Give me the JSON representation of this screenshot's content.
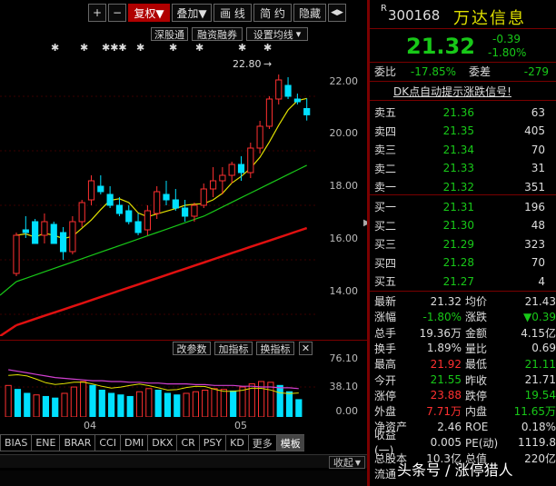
{
  "toolbar": {
    "plus": "+",
    "minus": "−",
    "fuquan": "复权▼",
    "diejia": "叠加▼",
    "huaxian": "画 线",
    "jianyue": "简 约",
    "yincang": "隐藏",
    "nav": "◀▶"
  },
  "sub_toolbar": {
    "shengutong": "深股通",
    "rongzi": "融资融券",
    "shezhi": "设置均线",
    "shezhi_arrow": "▾"
  },
  "main_chart": {
    "y_ticks": [
      "22.00",
      "20.00",
      "18.00",
      "16.00",
      "14.00"
    ],
    "high_label": "22.80",
    "ylim": [
      13.2,
      23.6
    ]
  },
  "sub_chart": {
    "buttons": [
      "改参数",
      "加指标",
      "换指标"
    ],
    "close": "✕",
    "y_ticks": [
      "76.10",
      "38.10",
      "0.00"
    ],
    "x_ticks": [
      "04",
      "05"
    ]
  },
  "indicator_tabs": [
    "BIAS",
    "ENE",
    "BRAR",
    "CCI",
    "DMI",
    "DKX",
    "CR",
    "PSY",
    "KD",
    "更多",
    "模板"
  ],
  "active_tab": "模板",
  "shouqi": "收起",
  "stock": {
    "prefix": "R",
    "code": "300168",
    "name": "万达信息",
    "price": "21.32",
    "change": "-0.39",
    "change_pct": "-1.80%",
    "webi_label": "委比",
    "webi": "-17.85%",
    "weicha_label": "委差",
    "weicha": "-279",
    "signal": "DK点自动提示涨跌信号!"
  },
  "sell": [
    {
      "label": "卖五",
      "price": "21.36",
      "vol": "63"
    },
    {
      "label": "卖四",
      "price": "21.35",
      "vol": "405"
    },
    {
      "label": "卖三",
      "price": "21.34",
      "vol": "70"
    },
    {
      "label": "卖二",
      "price": "21.33",
      "vol": "31"
    },
    {
      "label": "卖一",
      "price": "21.32",
      "vol": "351"
    }
  ],
  "buy": [
    {
      "label": "买一",
      "price": "21.31",
      "vol": "196"
    },
    {
      "label": "买二",
      "price": "21.30",
      "vol": "48"
    },
    {
      "label": "买三",
      "price": "21.29",
      "vol": "323"
    },
    {
      "label": "买四",
      "price": "21.28",
      "vol": "70"
    },
    {
      "label": "买五",
      "price": "21.27",
      "vol": "4"
    }
  ],
  "stats": [
    {
      "l1": "最新",
      "v1": "21.32",
      "c1": "w",
      "l2": "均价",
      "v2": "21.43",
      "c2": "w"
    },
    {
      "l1": "涨幅",
      "v1": "-1.80%",
      "c1": "g",
      "l2": "涨跌",
      "v2": "▼0.39",
      "c2": "g"
    },
    {
      "l1": "总手",
      "v1": "19.36万",
      "c1": "w",
      "l2": "金额",
      "v2": "4.15亿",
      "c2": "w"
    },
    {
      "l1": "换手",
      "v1": "1.89%",
      "c1": "w",
      "l2": "量比",
      "v2": "0.69",
      "c2": "w"
    },
    {
      "l1": "最高",
      "v1": "21.92",
      "c1": "r",
      "l2": "最低",
      "v2": "21.11",
      "c2": "g"
    },
    {
      "l1": "今开",
      "v1": "21.55",
      "c1": "g",
      "l2": "昨收",
      "v2": "21.71",
      "c2": "w"
    },
    {
      "l1": "涨停",
      "v1": "23.88",
      "c1": "r",
      "l2": "跌停",
      "v2": "19.54",
      "c2": "g"
    },
    {
      "l1": "外盘",
      "v1": "7.71万",
      "c1": "r",
      "l2": "内盘",
      "v2": "11.65万",
      "c2": "g"
    },
    {
      "l1": "净资产",
      "v1": "2.46",
      "c1": "w",
      "l2": "ROE",
      "v2": "0.18%",
      "c2": "w"
    },
    {
      "l1": "收益(一)",
      "v1": "0.005",
      "c1": "w",
      "l2": "PE(动)",
      "v2": "1119.8",
      "c2": "w"
    },
    {
      "l1": "总股本",
      "v1": "10.3亿",
      "c1": "w",
      "l2": "总值",
      "v2": "220亿",
      "c2": "w"
    },
    {
      "l1": "流通",
      "v1": "",
      "c1": "w",
      "l2": "",
      "v2": "",
      "c2": "w"
    }
  ],
  "watermark": "头条号 / 涨停猎人",
  "colors": {
    "up": "#ff3030",
    "down": "#00e0ff",
    "green": "#18c818",
    "ma_fast": "#e0e000",
    "ma_mid": "#18c818",
    "ma_slow": "#e01010"
  },
  "chart_data": {
    "type": "candlestick",
    "candles": [
      [
        15.5,
        17.0,
        15.4,
        16.9
      ],
      [
        17.1,
        17.6,
        16.8,
        17.0
      ],
      [
        17.4,
        17.5,
        16.6,
        16.6
      ],
      [
        16.9,
        17.7,
        16.6,
        17.4
      ],
      [
        17.3,
        17.4,
        16.6,
        16.6
      ],
      [
        17.0,
        17.2,
        16.0,
        16.3
      ],
      [
        16.3,
        17.6,
        16.2,
        17.4
      ],
      [
        17.4,
        18.2,
        17.2,
        18.1
      ],
      [
        18.2,
        19.1,
        18.0,
        18.9
      ],
      [
        18.7,
        19.1,
        18.4,
        18.5
      ],
      [
        18.4,
        18.7,
        17.9,
        18.0
      ],
      [
        18.0,
        18.3,
        17.6,
        17.7
      ],
      [
        17.8,
        18.0,
        17.3,
        17.4
      ],
      [
        17.4,
        17.7,
        16.9,
        17.0
      ],
      [
        17.1,
        18.0,
        16.9,
        17.8
      ],
      [
        17.7,
        18.7,
        17.5,
        18.5
      ],
      [
        18.4,
        18.9,
        18.0,
        18.2
      ],
      [
        18.2,
        18.6,
        17.8,
        17.9
      ],
      [
        17.9,
        18.2,
        17.4,
        17.6
      ],
      [
        17.6,
        18.1,
        17.4,
        18.0
      ],
      [
        18.0,
        18.8,
        17.9,
        18.6
      ],
      [
        18.6,
        19.4,
        18.3,
        18.9
      ],
      [
        18.9,
        19.4,
        18.4,
        19.1
      ],
      [
        19.1,
        19.6,
        18.8,
        19.5
      ],
      [
        19.5,
        19.8,
        18.9,
        19.2
      ],
      [
        19.2,
        20.3,
        19.0,
        20.1
      ],
      [
        20.1,
        21.1,
        19.9,
        20.9
      ],
      [
        20.9,
        22.0,
        20.8,
        21.9
      ],
      [
        21.9,
        22.8,
        21.7,
        22.6
      ],
      [
        22.4,
        22.7,
        21.9,
        22.0
      ],
      [
        21.9,
        22.1,
        21.7,
        21.8
      ],
      [
        21.55,
        21.92,
        21.11,
        21.32
      ]
    ],
    "volume": [
      40,
      35,
      30,
      28,
      26,
      24,
      30,
      38,
      45,
      40,
      34,
      30,
      28,
      26,
      32,
      36,
      34,
      30,
      28,
      30,
      32,
      34,
      36,
      35,
      33,
      38,
      42,
      45,
      44,
      40,
      32,
      22
    ],
    "indicator_line": [
      60,
      58,
      56,
      54,
      52,
      50,
      49,
      48,
      47,
      46,
      46,
      45,
      45,
      44,
      44,
      43,
      43,
      42,
      42,
      42,
      41,
      41,
      40,
      40,
      40,
      39,
      39,
      38,
      38,
      37,
      37,
      36
    ]
  }
}
